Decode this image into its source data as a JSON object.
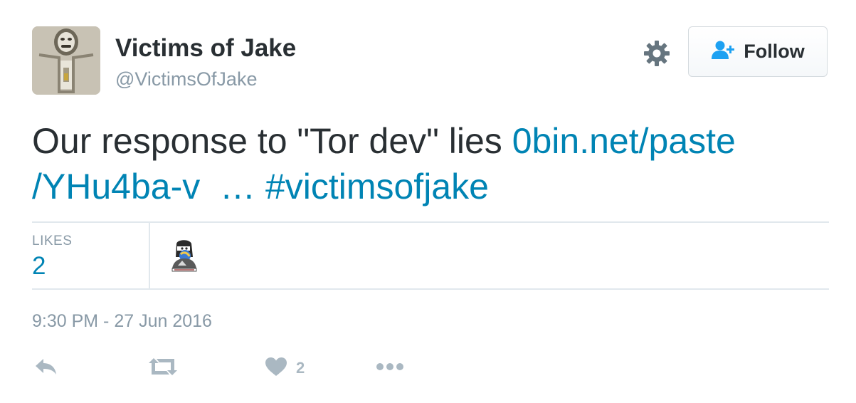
{
  "user": {
    "fullname": "Victims of Jake",
    "username": "@VictimsOfJake"
  },
  "follow_button": {
    "label": "Follow"
  },
  "tweet": {
    "text_plain": "Our response to \"Tor dev\" lies ",
    "link_line1": "0bin.net/paste",
    "link_line2": "/YHu4ba-v",
    "ellipsis": "…",
    "hashtag": "#victimsofjake"
  },
  "stats": {
    "likes_label": "LIKES",
    "likes_count": "2"
  },
  "timestamp": "9:30 PM - 27 Jun 2016",
  "actions": {
    "like_count": "2",
    "icons": [
      "reply-icon",
      "retweet-icon",
      "heart-icon",
      "more-icon"
    ]
  },
  "colors": {
    "text": "#292f33",
    "muted": "#8899a6",
    "link": "#0084b4",
    "action_icon": "#aab8c2",
    "divider": "#e1e8ed"
  }
}
